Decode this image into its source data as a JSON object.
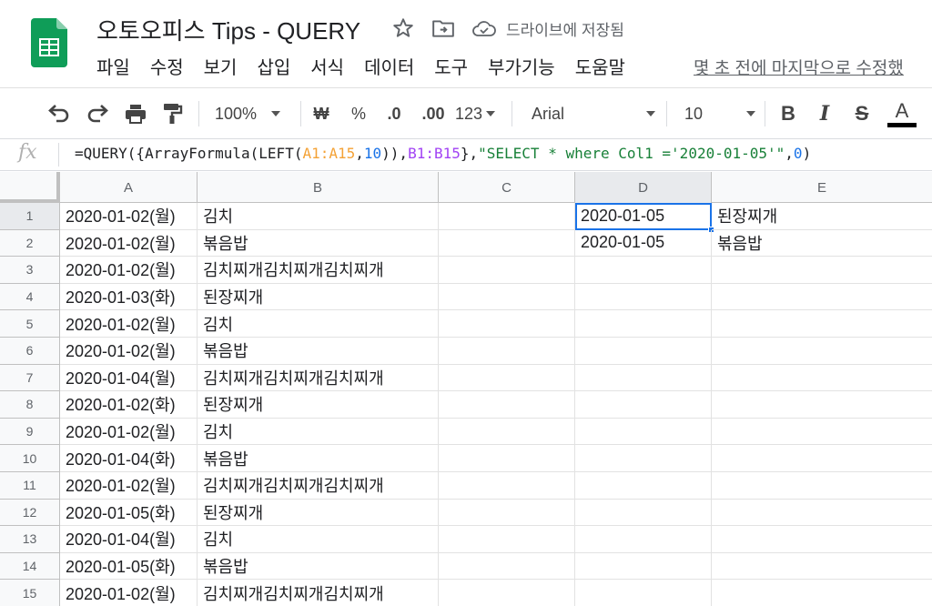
{
  "header": {
    "title": "오토오피스 Tips - QUERY",
    "drive_status": "드라이브에 저장됨",
    "last_edit": "몇 초 전에 마지막으로 수정했"
  },
  "menu": [
    "파일",
    "수정",
    "보기",
    "삽입",
    "서식",
    "데이터",
    "도구",
    "부가기능",
    "도움말"
  ],
  "toolbar": {
    "zoom": "100%",
    "currency": "₩",
    "percent": "%",
    "decrease_decimal": ".0",
    "increase_decimal": ".00",
    "more_formats": "123",
    "font": "Arial",
    "font_size": "10",
    "bold": "B",
    "italic": "I",
    "strike": "S",
    "text_color": "A"
  },
  "formula_bar": {
    "fx": "fx",
    "parts": {
      "p1": "=QUERY({ArrayFormula(LEFT(",
      "p2": "A1:A15",
      "p3": ",",
      "p4": "10",
      "p5": ")),",
      "p6": "B1:B15",
      "p7": "},",
      "p8": "\"SELECT * where Col1 ='2020-01-05'\"",
      "p9": ",",
      "p10": "0",
      "p11": ")"
    }
  },
  "columns": [
    "A",
    "B",
    "C",
    "D",
    "E"
  ],
  "rows": [
    {
      "n": "1",
      "A": "2020-01-02(월)",
      "B": "김치",
      "C": "",
      "D": "2020-01-05",
      "E": "된장찌개"
    },
    {
      "n": "2",
      "A": "2020-01-02(월)",
      "B": "볶음밥",
      "C": "",
      "D": "2020-01-05",
      "E": "볶음밥"
    },
    {
      "n": "3",
      "A": "2020-01-02(월)",
      "B": "김치찌개김치찌개김치찌개",
      "C": "",
      "D": "",
      "E": ""
    },
    {
      "n": "4",
      "A": "2020-01-03(화)",
      "B": "된장찌개",
      "C": "",
      "D": "",
      "E": ""
    },
    {
      "n": "5",
      "A": "2020-01-02(월)",
      "B": "김치",
      "C": "",
      "D": "",
      "E": ""
    },
    {
      "n": "6",
      "A": "2020-01-02(월)",
      "B": "볶음밥",
      "C": "",
      "D": "",
      "E": ""
    },
    {
      "n": "7",
      "A": "2020-01-04(월)",
      "B": "김치찌개김치찌개김치찌개",
      "C": "",
      "D": "",
      "E": ""
    },
    {
      "n": "8",
      "A": "2020-01-02(화)",
      "B": "된장찌개",
      "C": "",
      "D": "",
      "E": ""
    },
    {
      "n": "9",
      "A": "2020-01-02(월)",
      "B": "김치",
      "C": "",
      "D": "",
      "E": ""
    },
    {
      "n": "10",
      "A": "2020-01-04(화)",
      "B": "볶음밥",
      "C": "",
      "D": "",
      "E": ""
    },
    {
      "n": "11",
      "A": "2020-01-02(월)",
      "B": "김치찌개김치찌개김치찌개",
      "C": "",
      "D": "",
      "E": ""
    },
    {
      "n": "12",
      "A": "2020-01-05(화)",
      "B": "된장찌개",
      "C": "",
      "D": "",
      "E": ""
    },
    {
      "n": "13",
      "A": "2020-01-04(월)",
      "B": "김치",
      "C": "",
      "D": "",
      "E": ""
    },
    {
      "n": "14",
      "A": "2020-01-05(화)",
      "B": "볶음밥",
      "C": "",
      "D": "",
      "E": ""
    },
    {
      "n": "15",
      "A": "2020-01-02(월)",
      "B": "김치찌개김치찌개김치찌개",
      "C": "",
      "D": "",
      "E": ""
    }
  ],
  "colors": {
    "brand_green": "#0f9d58",
    "selection_blue": "#1a73e8"
  }
}
